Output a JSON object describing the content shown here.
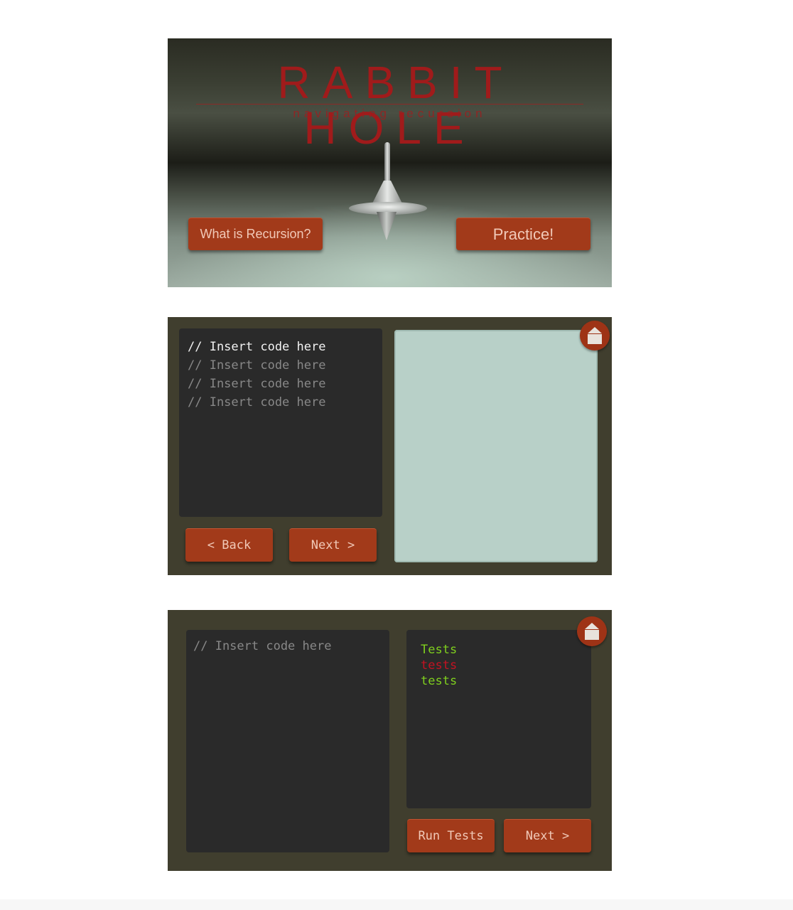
{
  "title_screen": {
    "title": "RABBIT HOLE",
    "subtitle": "navigating recursion",
    "what_button": "What is Recursion?",
    "practice_button": "Practice!"
  },
  "editor_screen": {
    "code_lines": [
      "// Insert code here",
      "// Insert code here",
      "// Insert code here",
      "// Insert code here"
    ],
    "back_button": "< Back",
    "next_button": "Next >"
  },
  "tests_screen": {
    "code_placeholder": "// Insert code here",
    "tests": [
      {
        "label": "Tests",
        "color": "#7fcf1e"
      },
      {
        "label": "tests",
        "color": "#c41222"
      },
      {
        "label": "tests",
        "color": "#7fcf1e"
      }
    ],
    "run_button": "Run Tests",
    "next_button": "Next >"
  },
  "colors": {
    "button": "#a23a1a",
    "panel": "#403e2e",
    "code_bg": "#2a2a2a",
    "preview_bg": "#b8d0c8",
    "pass": "#7fcf1e",
    "fail": "#c41222",
    "title": "#a01b1b"
  }
}
